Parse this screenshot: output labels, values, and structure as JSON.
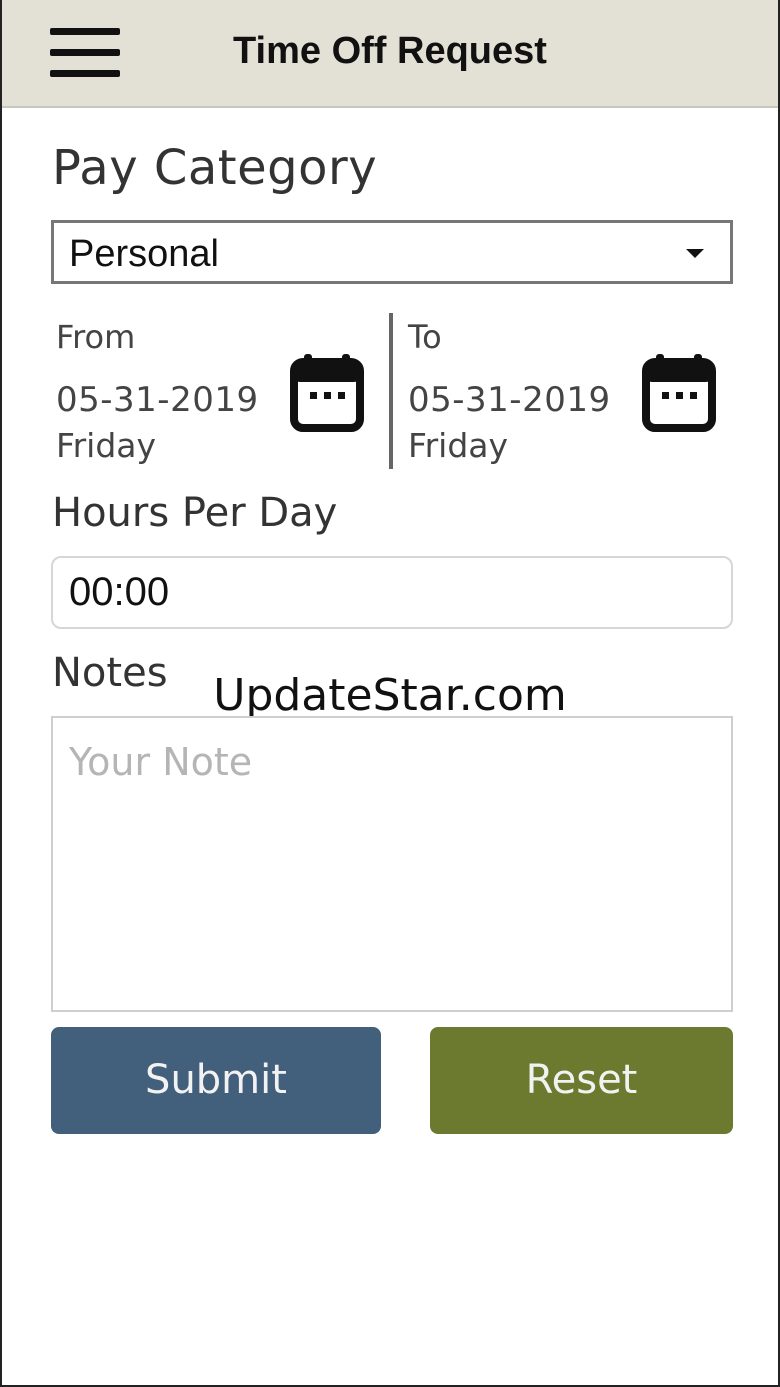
{
  "header": {
    "title": "Time Off Request",
    "menu_icon": "hamburger-menu-icon",
    "background": "#e3e1d6"
  },
  "form": {
    "pay_category": {
      "label": "Pay Category",
      "selected": "Personal"
    },
    "from": {
      "label": "From",
      "date": "05-31-2019",
      "day": "Friday",
      "icon": "calendar-icon"
    },
    "to": {
      "label": "To",
      "date": "05-31-2019",
      "day": "Friday",
      "icon": "calendar-icon"
    },
    "hours_per_day": {
      "label": "Hours Per Day",
      "value": "00:00"
    },
    "notes": {
      "label": "Notes",
      "placeholder": "Your Note"
    }
  },
  "buttons": {
    "submit": "Submit",
    "reset": "Reset"
  },
  "watermark": "UpdateStar.com",
  "colors": {
    "submit": "#425f7b",
    "reset": "#6b7a2f"
  }
}
